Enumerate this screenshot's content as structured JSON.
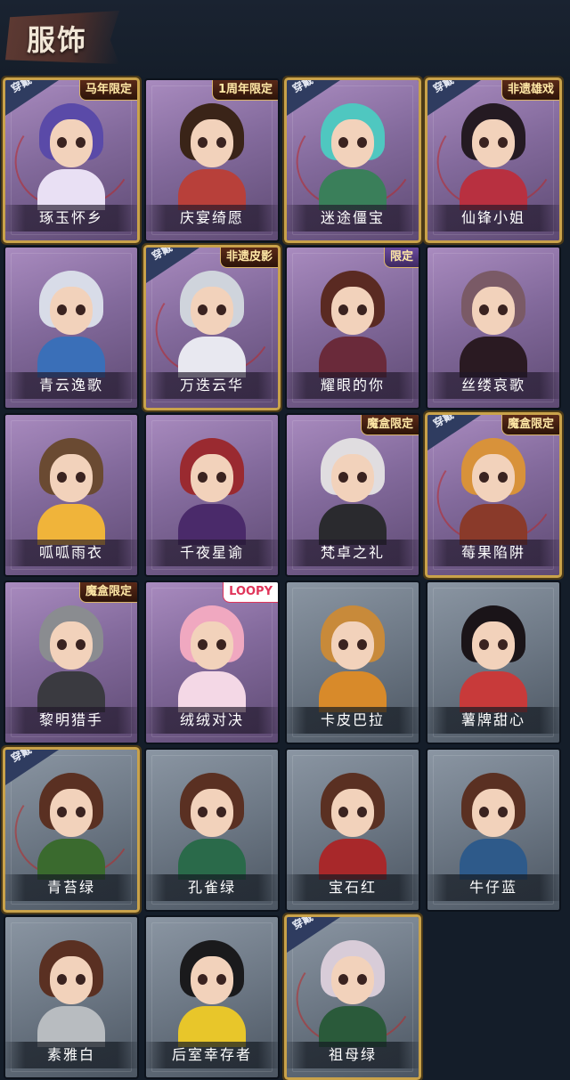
{
  "header": {
    "title": "服饰"
  },
  "worn_label": "穿戴",
  "cards": [
    {
      "name": "琢玉怀乡",
      "tag": "马年限定",
      "worn": true,
      "theme": "purple",
      "hair": "#5a4aa8",
      "outfit": "#e9e0f4"
    },
    {
      "name": "庆宴绮愿",
      "tag": "1周年限定",
      "worn": false,
      "theme": "purple",
      "hair": "#3a2418",
      "outfit": "#b8403a"
    },
    {
      "name": "迷途僵宝",
      "tag": "",
      "worn": true,
      "theme": "purple",
      "hair": "#4fc7c0",
      "outfit": "#3a7f5a"
    },
    {
      "name": "仙锋小姐",
      "tag": "非遗雄戏",
      "worn": true,
      "theme": "purple",
      "hair": "#241a22",
      "outfit": "#b83040"
    },
    {
      "name": "青云逸歌",
      "tag": "",
      "worn": false,
      "theme": "purple",
      "hair": "#d8dce8",
      "outfit": "#3a6fb8"
    },
    {
      "name": "万迭云华",
      "tag": "非遗皮影",
      "worn": true,
      "theme": "purple",
      "hair": "#cfd4dc",
      "outfit": "#e8e8f0"
    },
    {
      "name": "耀眼的你",
      "tag": "限定",
      "worn": false,
      "theme": "purple",
      "hair": "#5a2a22",
      "outfit": "#6a2a3a"
    },
    {
      "name": "丝缕哀歌",
      "tag": "",
      "worn": false,
      "theme": "purple",
      "hair": "#7a5a66",
      "outfit": "#2a1a22"
    },
    {
      "name": "呱呱雨衣",
      "tag": "",
      "worn": false,
      "theme": "purple",
      "hair": "#6a4a32",
      "outfit": "#f0b43a"
    },
    {
      "name": "千夜星谕",
      "tag": "",
      "worn": false,
      "theme": "purple",
      "hair": "#9a2a30",
      "outfit": "#4a2a6a"
    },
    {
      "name": "梵卓之礼",
      "tag": "魔盒限定",
      "worn": false,
      "theme": "purple",
      "hair": "#e0dde0",
      "outfit": "#2a2a2e"
    },
    {
      "name": "莓果陷阱",
      "tag": "魔盒限定",
      "worn": true,
      "theme": "purple",
      "hair": "#d8923a",
      "outfit": "#8a3a2a"
    },
    {
      "name": "黎明猎手",
      "tag": "魔盒限定",
      "worn": false,
      "theme": "purple",
      "hair": "#8a8c90",
      "outfit": "#3a3a40"
    },
    {
      "name": "绒绒对决",
      "tag": "LOOPY",
      "worn": false,
      "theme": "purple",
      "hair": "#f0a8c0",
      "outfit": "#f4d8e6"
    },
    {
      "name": "卡皮巴拉",
      "tag": "",
      "worn": false,
      "theme": "gray",
      "hair": "#c88a3a",
      "outfit": "#d88a2a"
    },
    {
      "name": "薯牌甜心",
      "tag": "",
      "worn": false,
      "theme": "gray",
      "hair": "#1a1418",
      "outfit": "#c83a3a"
    },
    {
      "name": "青苔绿",
      "tag": "",
      "worn": true,
      "theme": "gray",
      "hair": "#5a3022",
      "outfit": "#3a6a2e"
    },
    {
      "name": "孔雀绿",
      "tag": "",
      "worn": false,
      "theme": "gray",
      "hair": "#5a3022",
      "outfit": "#2a6a4a"
    },
    {
      "name": "宝石红",
      "tag": "",
      "worn": false,
      "theme": "gray",
      "hair": "#5a3022",
      "outfit": "#a8282a"
    },
    {
      "name": "牛仔蓝",
      "tag": "",
      "worn": false,
      "theme": "gray",
      "hair": "#5a3022",
      "outfit": "#2e5a8a"
    },
    {
      "name": "素雅白",
      "tag": "",
      "worn": false,
      "theme": "gray",
      "hair": "#5a3022",
      "outfit": "#b8bcc0"
    },
    {
      "name": "后室幸存者",
      "tag": "",
      "worn": false,
      "theme": "gray",
      "hair": "#1a1a1c",
      "outfit": "#e8c62a"
    },
    {
      "name": "祖母绿",
      "tag": "",
      "worn": true,
      "theme": "gray",
      "hair": "#d8ccd8",
      "outfit": "#2a5a3a"
    }
  ]
}
